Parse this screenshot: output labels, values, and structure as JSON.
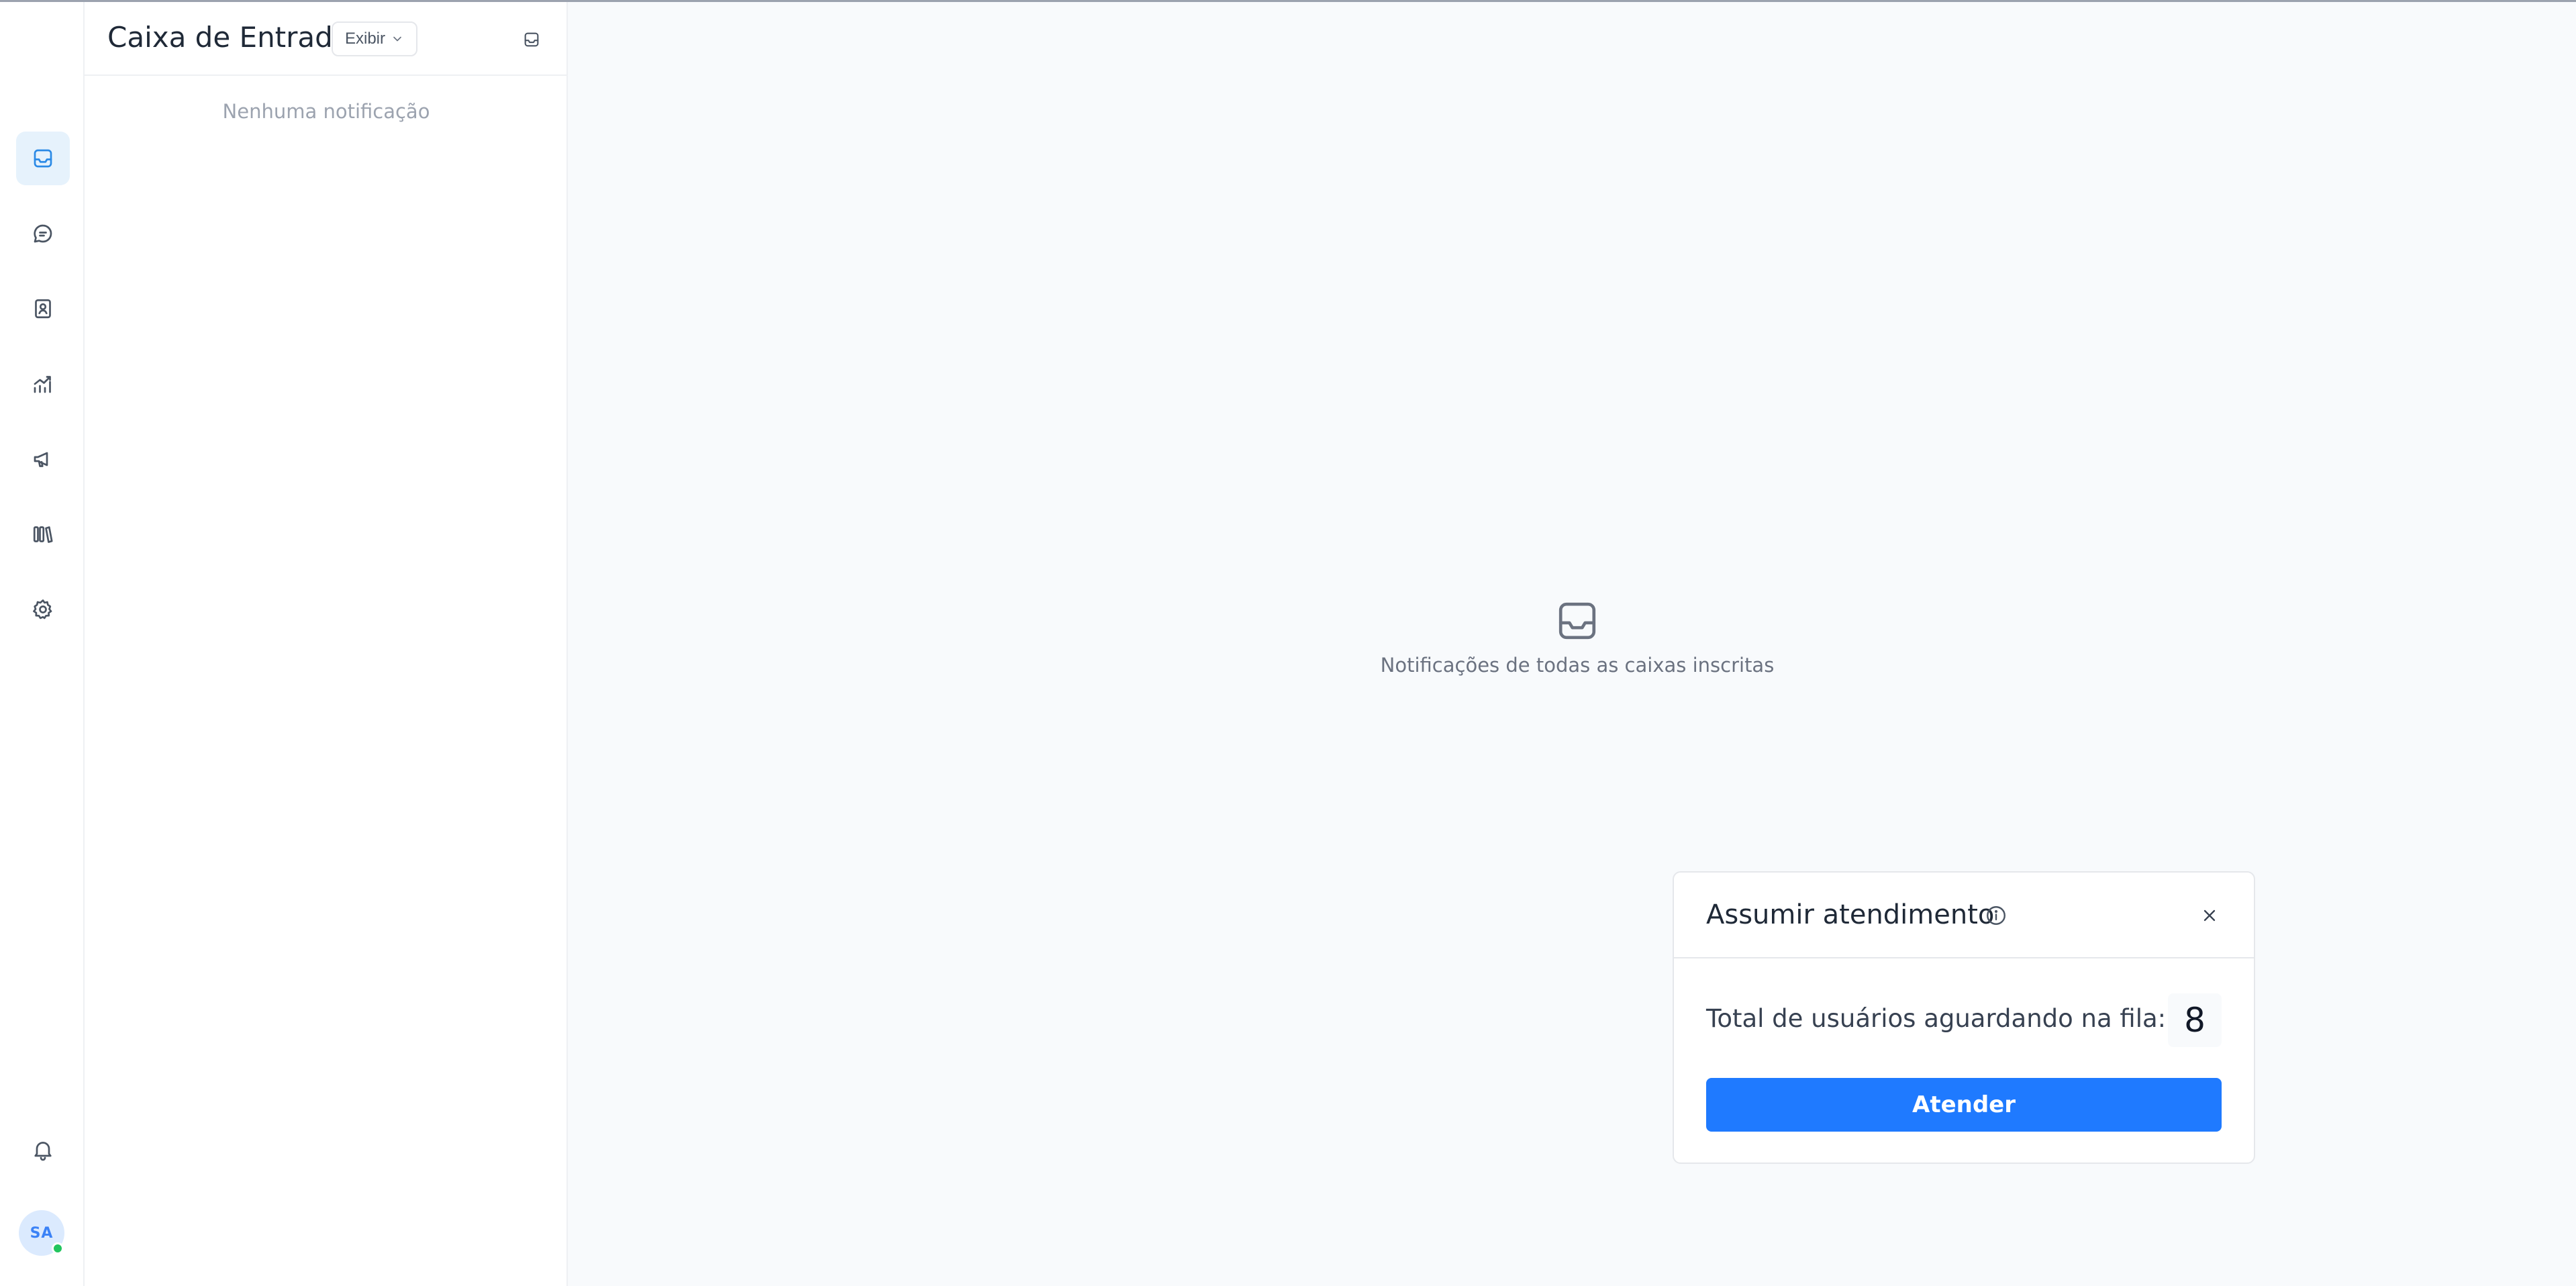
{
  "sidebar": {
    "items": [
      {
        "name": "inbox",
        "icon": "inbox-icon",
        "active": true
      },
      {
        "name": "conversations",
        "icon": "chat-icon",
        "active": false
      },
      {
        "name": "contacts",
        "icon": "contacts-icon",
        "active": false
      },
      {
        "name": "reports",
        "icon": "chart-icon",
        "active": false
      },
      {
        "name": "campaigns",
        "icon": "megaphone-icon",
        "active": false
      },
      {
        "name": "library",
        "icon": "library-icon",
        "active": false
      },
      {
        "name": "settings",
        "icon": "gear-icon",
        "active": false
      }
    ],
    "notifications_icon": "bell-icon",
    "avatar_initials": "SA",
    "status_color": "#22c55e"
  },
  "panel": {
    "title": "Caixa de Entrada",
    "view_label": "Exibir",
    "empty_text": "Nenhuma notificação"
  },
  "main": {
    "empty_text": "Notificações de todas as caixas inscritas"
  },
  "queue_card": {
    "title": "Assumir atendimento",
    "label": "Total de usuários aguardando na fila:",
    "count": "8",
    "button_label": "Atender",
    "accent": "#1f7aff"
  }
}
